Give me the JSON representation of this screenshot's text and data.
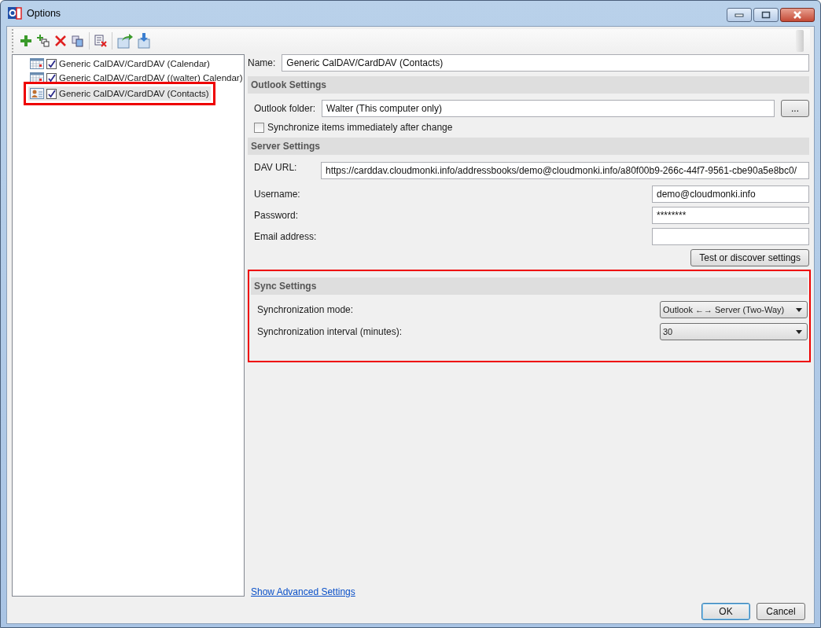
{
  "window": {
    "title": "Options"
  },
  "profiles": [
    {
      "name": "Generic CalDAV/CardDAV (Calendar)",
      "kind": "calendar",
      "checked": true,
      "selected": false,
      "highlighted": false
    },
    {
      "name": "Generic CalDAV/CardDAV ((walter) Calendar)",
      "kind": "calendar",
      "checked": true,
      "selected": false,
      "highlighted": false
    },
    {
      "name": "Generic CalDAV/CardDAV (Contacts)",
      "kind": "contacts",
      "checked": true,
      "selected": true,
      "highlighted": true
    }
  ],
  "name_field": {
    "label": "Name:",
    "value": "Generic CalDAV/CardDAV (Contacts)"
  },
  "outlook_settings": {
    "title": "Outlook Settings",
    "folder_label": "Outlook folder:",
    "folder_value": "Walter (This computer only)",
    "browse_button": "...",
    "sync_immediately": {
      "label": "Synchronize items immediately after change",
      "checked": false
    }
  },
  "server_settings": {
    "title": "Server Settings",
    "dav_url": {
      "label": "DAV URL:",
      "value": "https://carddav.cloudmonki.info/addressbooks/demo@cloudmonki.info/a80f00b9-266c-44f7-9561-cbe90a5e8bc0/"
    },
    "fields": [
      {
        "label": "Username:",
        "value": "demo@cloudmonki.info"
      },
      {
        "label": "Password:",
        "value": "********"
      },
      {
        "label": "Email address:"
      }
    ],
    "test_button": "Test or discover settings"
  },
  "sync_settings": {
    "title": "Sync Settings",
    "highlighted": true,
    "rows": [
      {
        "label": "Synchronization mode:",
        "value": "Outlook ←→ Server (Two-Way)"
      },
      {
        "label": "Synchronization interval (minutes):",
        "value": "30"
      }
    ]
  },
  "advanced_link": "Show Advanced Settings",
  "buttons": [
    {
      "label": "OK",
      "default": true
    },
    {
      "label": "Cancel",
      "default": false
    }
  ]
}
